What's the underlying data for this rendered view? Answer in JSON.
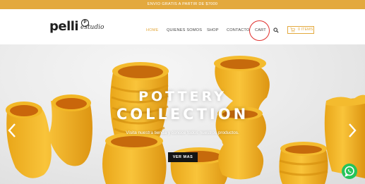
{
  "topbar": {
    "text": "ENVIO GRATIS A PARTIR DE $7000"
  },
  "brand": {
    "name": "pelli",
    "sub": "estudio",
    "mark": "P"
  },
  "nav": {
    "items": [
      {
        "label": "HOME",
        "active": true
      },
      {
        "label": "QUIENES SOMOS",
        "active": false
      },
      {
        "label": "SHOP",
        "active": false
      },
      {
        "label": "CONTACTO",
        "active": false
      },
      {
        "label": "CART",
        "active": false
      }
    ],
    "cart_button": "0 ITEMS"
  },
  "hero": {
    "title_line1": "POTTERY",
    "title_line2": "COLLECTION",
    "subtitle": "Visita nuestra tienda y conoce todos nuestros productos.",
    "cta": "VER MAS"
  },
  "colors": {
    "accent": "#e3a93e",
    "pot_yellow": "#f2b726",
    "annotation": "#e0312f",
    "whatsapp": "#25c45a"
  },
  "icons": [
    "search-icon",
    "cart-icon",
    "chevron-left-icon",
    "chevron-right-icon",
    "whatsapp-icon"
  ]
}
